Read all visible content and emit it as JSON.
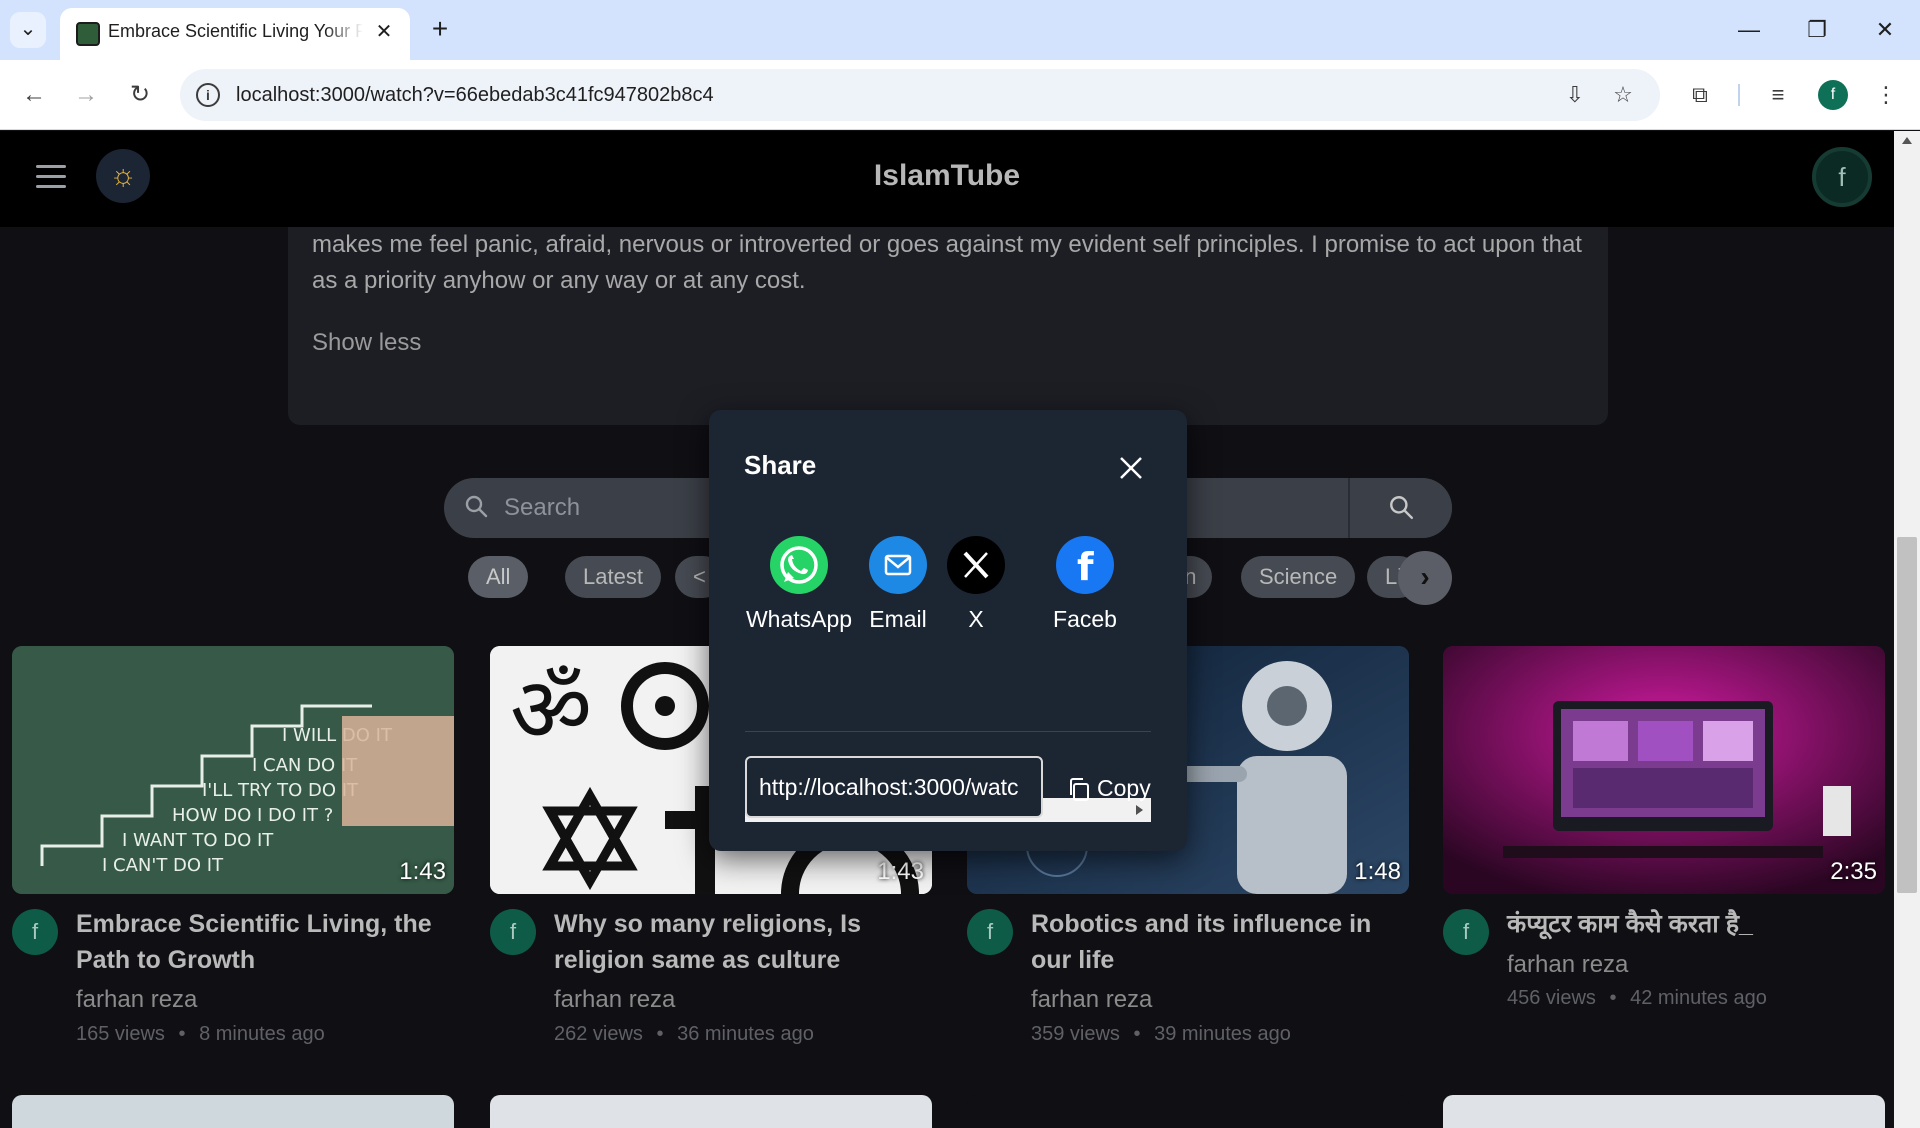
{
  "browser": {
    "tab_title": "Embrace Scientific Living Your P",
    "url": "localhost:3000/watch?v=66ebedab3c41fc947802b8c4",
    "profile_initial": "f"
  },
  "header": {
    "brand": "IslamTube",
    "avatar_initial": "f"
  },
  "description": {
    "text": "programmatic approach for positive influence on the non understandable, whatever the action of the decided path that makes me feel panic, afraid, nervous or introverted or goes against my evident self principles. I promise to act upon that as a priority anyhow or any way or at any cost.",
    "show_less": "Show less"
  },
  "search": {
    "placeholder": "Search"
  },
  "chips": [
    "All",
    "Latest",
    "<",
    "on",
    "Science",
    "Li"
  ],
  "videos": [
    {
      "title": "Embrace Scientific Living, the Path to Growth",
      "channel": "farhan reza",
      "views": "165 views",
      "age": "8 minutes ago",
      "duration": "1:43",
      "avatar": "f"
    },
    {
      "title": "Why so many religions, Is religion same as culture",
      "channel": "farhan reza",
      "views": "262 views",
      "age": "36 minutes ago",
      "duration": "1:43",
      "avatar": "f"
    },
    {
      "title": "Robotics and its influence in our life",
      "channel": "farhan reza",
      "views": "359 views",
      "age": "39 minutes ago",
      "duration": "1:48",
      "avatar": "f"
    },
    {
      "title": "कंप्यूटर काम कैसे करता है_",
      "channel": "farhan reza",
      "views": "456 views",
      "age": "42 minutes ago",
      "duration": "2:35",
      "avatar": "f"
    }
  ],
  "meta_separator": "•",
  "share_modal": {
    "title": "Share",
    "options": [
      {
        "label": "WhatsApp",
        "icon": "whatsapp-icon",
        "color": "#25D366"
      },
      {
        "label": "Email",
        "icon": "email-icon",
        "color": "#1E88E5"
      },
      {
        "label": "X",
        "icon": "x-icon",
        "color": "#000000"
      },
      {
        "label": "Faceb",
        "icon": "facebook-icon",
        "color": "#1877F2"
      }
    ],
    "url_value": "http://localhost:3000/watc",
    "copy_label": "Copy"
  },
  "colors": {
    "accent_avatar": "#0e7157",
    "modal_bg": "#1c2532",
    "header_bg": "#000000"
  }
}
